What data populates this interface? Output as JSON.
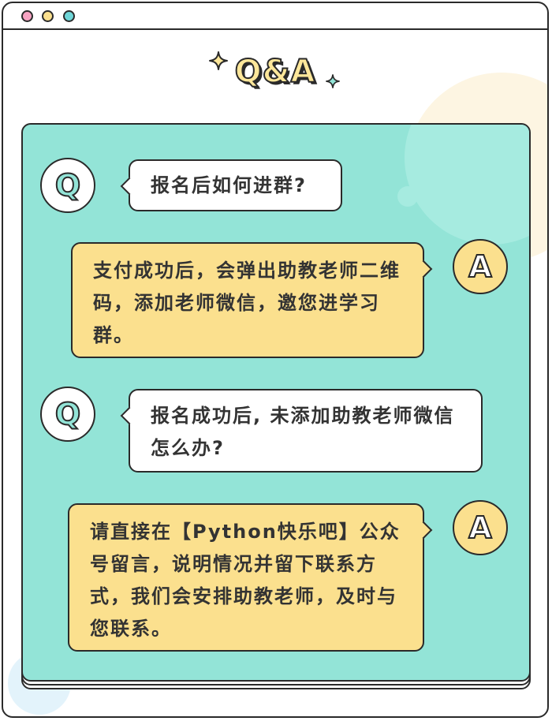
{
  "title": "Q&A",
  "colors": {
    "card_bg": "#93e4d7",
    "answer_bubble": "#fbe08e",
    "question_bubble": "#ffffff",
    "outline": "#2a2a2a",
    "window_dots": [
      "#f7a3c2",
      "#fbe08e",
      "#6fd6d8"
    ]
  },
  "icons": [
    "sparkle-icon",
    "sparkle-icon"
  ],
  "faq": [
    {
      "badge": "Q",
      "text": "报名后如何进群?"
    },
    {
      "badge": "A",
      "text": "支付成功后，会弹出助教老师二维码，添加老师微信，邀您进学习群。"
    },
    {
      "badge": "Q",
      "text": "报名成功后, 未添加助教老师微信怎么办?"
    },
    {
      "badge": "A",
      "text": "请直接在【Python快乐吧】公众号留言，说明情况并留下联系方式，我们会安排助教老师，及时与您联系。"
    }
  ]
}
